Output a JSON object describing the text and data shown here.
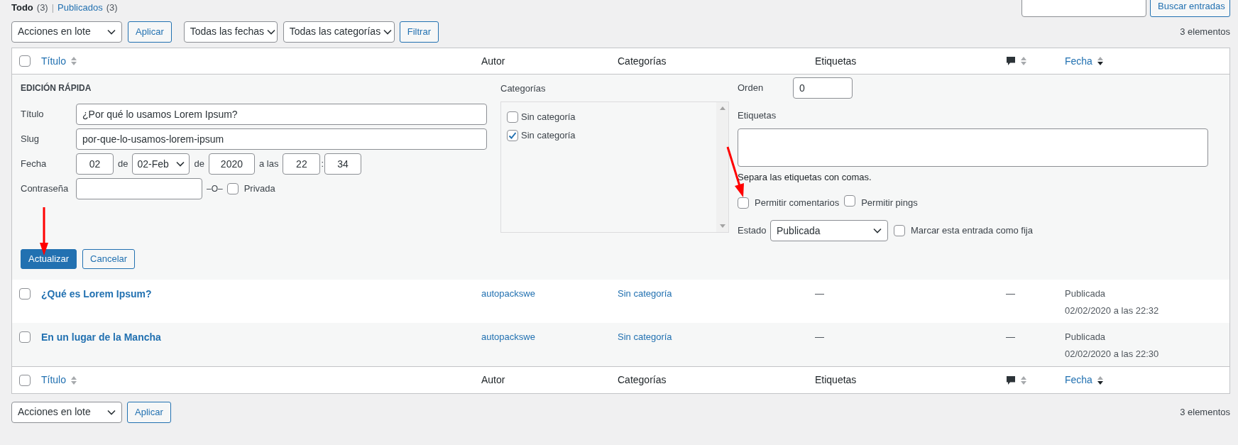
{
  "views": [
    {
      "label": "Todo",
      "count": "(3)",
      "selected": true
    },
    {
      "label": "Publicados",
      "count": "(3)",
      "selected": false
    }
  ],
  "view_separator": "|",
  "search": {
    "button": "Buscar entradas"
  },
  "toolbar": {
    "bulk_action": "Acciones en lote",
    "apply": "Aplicar",
    "date_filter": "Todas las fechas",
    "category_filter": "Todas las categorías",
    "filter": "Filtrar",
    "count": "3 elementos"
  },
  "columns": [
    {
      "kind": "check",
      "checked": false
    },
    {
      "kind": "text",
      "label": "Título",
      "sortable": true,
      "sorted": false
    },
    {
      "kind": "text",
      "label": "Autor",
      "sortable": false
    },
    {
      "kind": "text",
      "label": "Categorías",
      "sortable": false
    },
    {
      "kind": "text",
      "label": "Etiquetas",
      "sortable": false
    },
    {
      "kind": "comments",
      "sortable": true,
      "sorted": false
    },
    {
      "kind": "text",
      "label": "Fecha",
      "sortable": true,
      "sorted": true
    }
  ],
  "quick_edit": {
    "heading": "EDICIÓN RÁPIDA",
    "title": {
      "label": "Título",
      "value": "¿Por qué lo usamos Lorem Ipsum?"
    },
    "slug": {
      "label": "Slug",
      "value": "por-que-lo-usamos-lorem-ipsum"
    },
    "date": {
      "label": "Fecha",
      "day": "02",
      "of_1": "de",
      "month": "02-Feb",
      "of_2": "de",
      "year": "2020",
      "at": "a las",
      "hour": "22",
      "colon": ":",
      "minute": "34"
    },
    "password": {
      "label": "Contraseña",
      "or": "–O–",
      "private_label": "Privada",
      "private_checked": false
    },
    "categories": {
      "label": "Categorías",
      "items": [
        {
          "label": "Sin categoría",
          "checked": false
        },
        {
          "label": "Sin categoría",
          "checked": true
        }
      ]
    },
    "order": {
      "label": "Orden",
      "value": "0"
    },
    "tags": {
      "label": "Etiquetas",
      "hint": "Separa las etiquetas con comas."
    },
    "allow_comments": {
      "label": "Permitir comentarios",
      "checked": false
    },
    "allow_pings": {
      "label": "Permitir pings",
      "checked": false
    },
    "status": {
      "label": "Estado",
      "value": "Publicada"
    },
    "sticky": {
      "label": "Marcar esta entrada como fija",
      "checked": false
    },
    "update": "Actualizar",
    "cancel": "Cancelar"
  },
  "rows": [
    {
      "checked": false,
      "title": "¿Qué es Lorem Ipsum?",
      "author": "autopackswe",
      "category": "Sin categoría",
      "tags": "—",
      "comments": "—",
      "status": "Publicada",
      "date": "02/02/2020 a las 22:32"
    },
    {
      "checked": false,
      "title": "En un lugar de la Mancha",
      "author": "autopackswe",
      "category": "Sin categoría",
      "tags": "—",
      "comments": "—",
      "status": "Publicada",
      "date": "02/02/2020 a las 22:30"
    }
  ],
  "footer_columns": [
    {
      "kind": "check",
      "checked": false
    },
    {
      "kind": "text",
      "label": "Título",
      "sortable": true,
      "sorted": false
    },
    {
      "kind": "text",
      "label": "Autor",
      "sortable": false
    },
    {
      "kind": "text",
      "label": "Categorías",
      "sortable": false
    },
    {
      "kind": "text",
      "label": "Etiquetas",
      "sortable": false
    },
    {
      "kind": "comments",
      "sortable": true,
      "sorted": false
    },
    {
      "kind": "text",
      "label": "Fecha",
      "sortable": true,
      "sorted": true
    }
  ],
  "bottom_toolbar": {
    "bulk_action": "Acciones en lote",
    "apply": "Aplicar",
    "count": "3 elementos"
  }
}
